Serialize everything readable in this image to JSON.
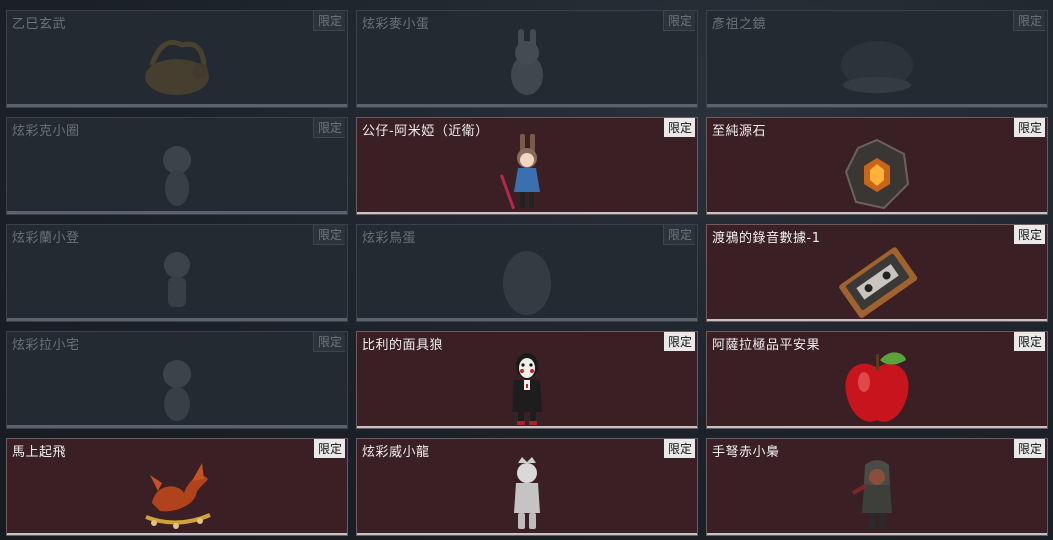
{
  "badge_label": "限定",
  "items": [
    {
      "name": "乙巳玄武",
      "state": "locked",
      "icon": "dragon-turtle-icon"
    },
    {
      "name": "炫彩麥小蛋",
      "state": "locked",
      "icon": "bunny-figure-icon"
    },
    {
      "name": "彥祖之鏡",
      "state": "locked",
      "icon": "mirror-icon"
    },
    {
      "name": "炫彩克小圈",
      "state": "locked",
      "icon": "chibi-figure-icon"
    },
    {
      "name": "公仔-阿米婭（近衛）",
      "state": "owned",
      "icon": "amiya-figure-icon"
    },
    {
      "name": "至純源石",
      "state": "owned",
      "icon": "originium-crystal-icon"
    },
    {
      "name": "炫彩蘭小登",
      "state": "locked",
      "icon": "chibi-figure-icon"
    },
    {
      "name": "炫彩鳥蛋",
      "state": "locked",
      "icon": "egg-icon"
    },
    {
      "name": "渡鴉的錄音數據-1",
      "state": "owned",
      "icon": "cassette-tape-icon"
    },
    {
      "name": "炫彩拉小宅",
      "state": "locked",
      "icon": "chibi-figure-icon"
    },
    {
      "name": "比利的面具狼",
      "state": "owned",
      "icon": "puppet-mask-figure-icon"
    },
    {
      "name": "阿薩拉極品平安果",
      "state": "owned",
      "icon": "red-apple-icon"
    },
    {
      "name": "馬上起飛",
      "state": "owned",
      "icon": "golden-horse-icon"
    },
    {
      "name": "炫彩威小龍",
      "state": "owned",
      "icon": "silver-figure-icon"
    },
    {
      "name": "手弩赤小梟",
      "state": "owned",
      "icon": "crossbow-figure-icon"
    }
  ]
}
